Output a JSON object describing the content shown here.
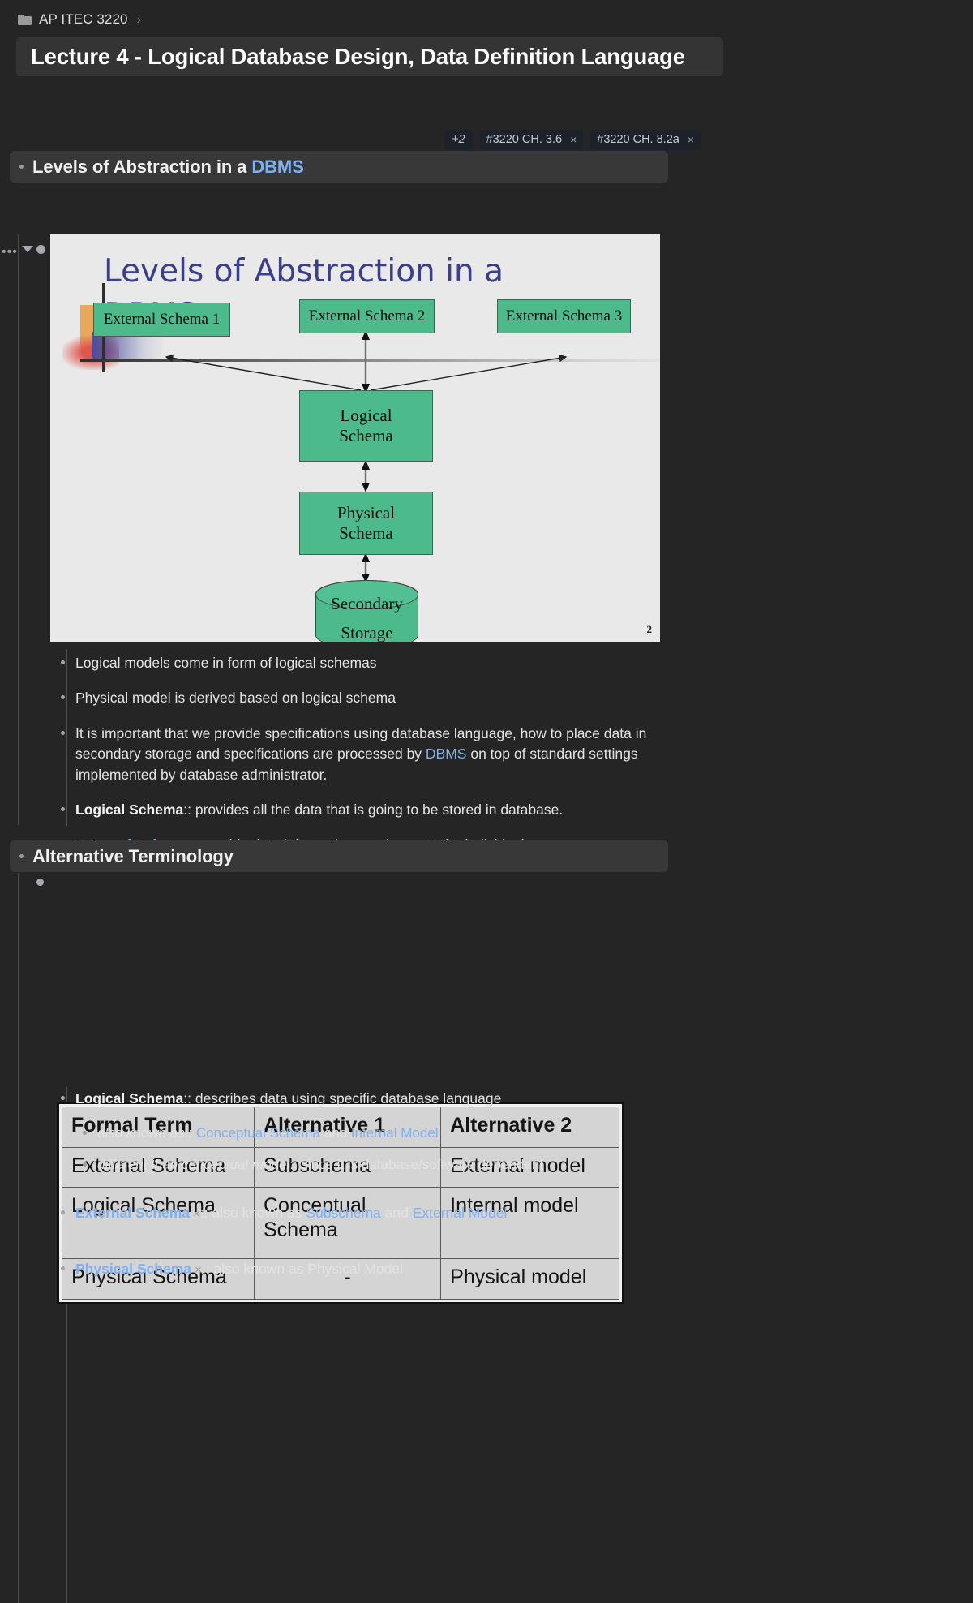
{
  "breadcrumb": {
    "icon": "folder-icon",
    "label": "AP ITEC 3220",
    "chevron": "›"
  },
  "header": {
    "title": "Lecture 4 - Logical Database Design, Data Definition Language"
  },
  "tags": [
    {
      "label": "+2",
      "closable": false
    },
    {
      "label": "#3220 CH. 3.6",
      "closable": true,
      "close": "×"
    },
    {
      "label": "#3220 CH. 8.2a",
      "closable": true,
      "close": "×"
    }
  ],
  "sections": [
    {
      "title_plain": "Levels of Abstraction in a ",
      "title_accent": "DBMS"
    },
    {
      "title_plain": "Alternative Terminology",
      "title_accent": ""
    }
  ],
  "slide": {
    "title": "Levels of Abstraction in a DBMS",
    "page_number": "2",
    "nodes": {
      "external_1": "External Schema 1",
      "external_2": "External Schema 2",
      "external_3": "External Schema 3",
      "logical": "Logical\nSchema",
      "logical_line1": "Logical",
      "logical_line2": "Schema",
      "physical_line1": "Physical",
      "physical_line2": "Schema",
      "storage_line1": "Secondary",
      "storage_line2": "Storage"
    },
    "colors": {
      "node_fill": "#4cba8a",
      "title": "#3b3f88",
      "background": "#e9e9e9"
    }
  },
  "notes_1": [
    {
      "parts": [
        {
          "t": "Logical models come in form of logical schemas",
          "s": "n"
        }
      ]
    },
    {
      "parts": [
        {
          "t": "Physical model is derived based on logical schema",
          "s": "n"
        }
      ]
    },
    {
      "parts": [
        {
          "t": "It is important that we provide specifications using database language, how to place data in secondary storage and specifications are processed by ",
          "s": "n"
        },
        {
          "t": "DBMS",
          "s": "lk"
        },
        {
          "t": " on top of standard settings implemented by database administrator.",
          "s": "n"
        }
      ]
    },
    {
      "parts": [
        {
          "t": "Logical Schema",
          "s": "b"
        },
        {
          "t": ":: provides all the data that is going to be stored in database.",
          "s": "n"
        }
      ]
    },
    {
      "parts": [
        {
          "t": "External Schema",
          "s": "lkb"
        },
        {
          "t": ":: provide data information requirements for individual user groups",
          "s": "n"
        }
      ]
    }
  ],
  "table": {
    "headers": [
      "Formal Term",
      "Alternative 1",
      "Alternative 2"
    ],
    "rows": [
      [
        "External Schema",
        "Subschema",
        "External model"
      ],
      [
        "Logical Schema",
        "Conceptual Schema",
        "Internal model"
      ],
      [
        "Physical Schema",
        "-",
        "Physical model"
      ]
    ]
  },
  "notes_2": [
    {
      "parts": [
        {
          "t": "Logical Schema",
          "s": "b"
        },
        {
          "t": ":: describes data using specific database language",
          "s": "n"
        }
      ],
      "children": [
        {
          "parts": [
            {
              "t": "also known as",
              "s": "i"
            },
            {
              "t": ":: ",
              "s": "n"
            },
            {
              "t": "Conceptual Schema",
              "s": "lk"
            },
            {
              "t": " and ",
              "s": "n"
            },
            {
              "t": "Internal Model",
              "s": "lk"
            }
          ]
        },
        {
          "parts": [
            {
              "t": "different than conceptual model",
              "s": "i"
            },
            {
              "t": ":: since it is database/software dependent",
              "s": "n"
            }
          ]
        }
      ]
    },
    {
      "parts": [
        {
          "t": "External Schema",
          "s": "lkb"
        },
        {
          "t": " ×",
          "s": "x"
        },
        {
          "t": ":: also known as ",
          "s": "n"
        },
        {
          "t": "Subschema",
          "s": "lk"
        },
        {
          "t": " and ",
          "s": "n"
        },
        {
          "t": "External Model",
          "s": "lk"
        }
      ]
    },
    {
      "parts": [
        {
          "t": "Physical Schema",
          "s": "lkb"
        },
        {
          "t": " ×",
          "s": "x"
        },
        {
          "t": ":: also known as Physical Model",
          "s": "n"
        }
      ]
    }
  ],
  "colors": {
    "background": "#252525",
    "panel": "#343434",
    "section_header": "#383838",
    "accent_link": "#7fb0f0",
    "tag_bg": "#1d2129"
  }
}
